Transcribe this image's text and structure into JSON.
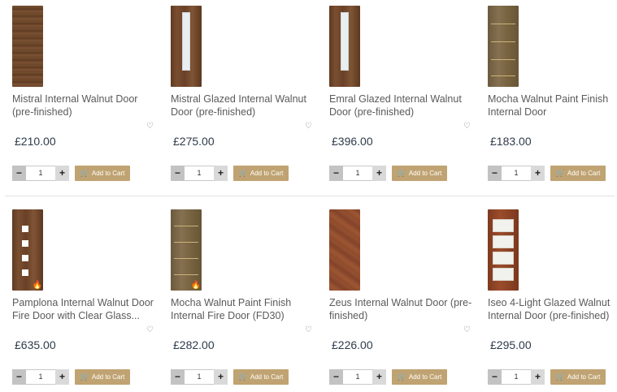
{
  "products": [
    {
      "title": "Mistral Internal Walnut Door (pre-finished)",
      "price": "£210.00",
      "qty": "1",
      "add_label": "Add to Cart",
      "image": "walnut-door",
      "fire": false
    },
    {
      "title": "Mistral Glazed Internal Walnut Door (pre-finished)",
      "price": "£275.00",
      "qty": "1",
      "add_label": "Add to Cart",
      "image": "walnut-glazed-door",
      "fire": false
    },
    {
      "title": "Emral Glazed Internal Walnut Door (pre-finished)",
      "price": "£396.00",
      "qty": "1",
      "add_label": "Add to Cart",
      "image": "walnut-glazed-door",
      "fire": false
    },
    {
      "title": "Mocha Walnut Paint Finish Internal Door",
      "price": "£183.00",
      "qty": "1",
      "add_label": "Add to Cart",
      "image": "mocha-inlay-door",
      "fire": false
    },
    {
      "title": "Pamplona Internal Walnut Door Fire Door with Clear Glass...",
      "price": "£635.00",
      "qty": "1",
      "add_label": "Add to Cart",
      "image": "walnut-square-glass-door",
      "fire": true
    },
    {
      "title": "Mocha Walnut Paint Finish Internal Fire Door (FD30)",
      "price": "£282.00",
      "qty": "1",
      "add_label": "Add to Cart",
      "image": "mocha-inlay-door",
      "fire": true
    },
    {
      "title": "Zeus Internal Walnut Door (pre-finished)",
      "price": "£226.00",
      "qty": "1",
      "add_label": "Add to Cart",
      "image": "walnut-zigzag-door",
      "fire": false
    },
    {
      "title": "Iseo 4-Light Glazed Walnut Internal Door (pre-finished)",
      "price": "£295.00",
      "qty": "1",
      "add_label": "Add to Cart",
      "image": "walnut-4-light-door",
      "fire": false
    }
  ],
  "qty_minus": "−",
  "qty_plus": "+",
  "icons": {
    "wishlist": "heart-outline-icon",
    "cart": "cart-icon",
    "fire": "fire-icon"
  },
  "colors": {
    "add_button": "#c0a372",
    "price": "#2d3b4a",
    "title": "#5a5a5a"
  }
}
